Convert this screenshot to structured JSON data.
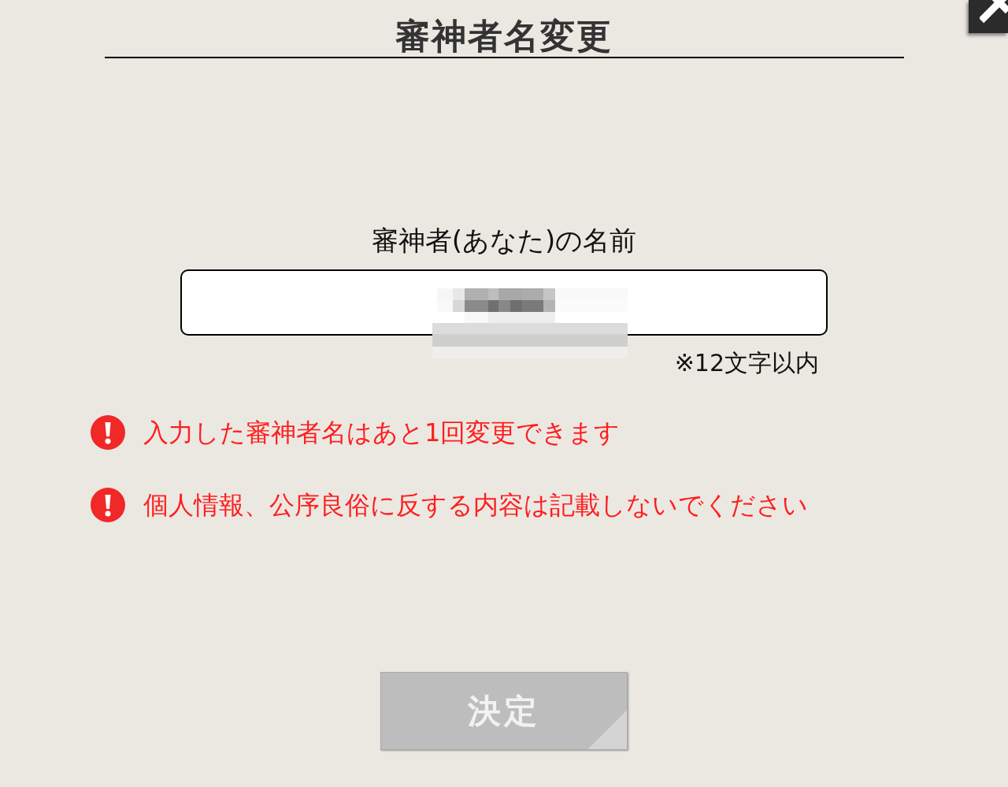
{
  "title": "審神者名変更",
  "name_field": {
    "label": "審神者(あなた)の名前",
    "value_redacted": true,
    "note": "※12文字以内"
  },
  "notices": [
    {
      "text": "入力した審神者名はあと1回変更できます"
    },
    {
      "text": "個人情報、公序良俗に反する内容は記載しないでください"
    }
  ],
  "submit_button": {
    "label": "決定",
    "disabled": true
  }
}
